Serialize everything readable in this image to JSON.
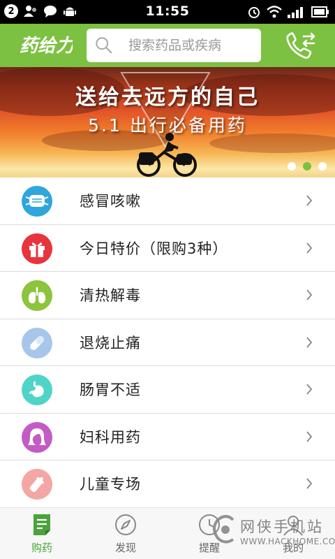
{
  "status_bar": {
    "notification_count": "2",
    "time": "11:55"
  },
  "header": {
    "logo_text": "药给力",
    "search_placeholder": "搜索药品或疾病"
  },
  "banner": {
    "title": "送给去远方的自己",
    "subtitle": "5.1 出行必备用药",
    "dots": 3,
    "active_dot": 1
  },
  "categories": [
    {
      "label": "感冒咳嗽",
      "icon": "mask-icon",
      "color": "#2fa6dd"
    },
    {
      "label": "今日特价（限购3种）",
      "icon": "gift-icon",
      "color": "#e8343c"
    },
    {
      "label": "清热解毒",
      "icon": "lungs-icon",
      "color": "#8cc43c"
    },
    {
      "label": "退烧止痛",
      "icon": "pill-icon",
      "color": "#a8c6ea"
    },
    {
      "label": "肠胃不适",
      "icon": "stomach-icon",
      "color": "#4fd5c8"
    },
    {
      "label": "妇科用药",
      "icon": "woman-icon",
      "color": "#c35bc6"
    },
    {
      "label": "儿童专场",
      "icon": "baby-bottle-icon",
      "color": "#f4a6a4"
    }
  ],
  "tabs": [
    {
      "label": "购药",
      "icon": "shopping-doc-icon",
      "active": true
    },
    {
      "label": "发现",
      "icon": "compass-icon",
      "active": false
    },
    {
      "label": "提醒",
      "icon": "clock-icon",
      "active": false
    },
    {
      "label": "我的",
      "icon": "user-icon",
      "active": false
    }
  ],
  "watermark": {
    "name": "网侠手机站",
    "url": "WWW.HACKHOME.COM"
  },
  "colors": {
    "brand_green": "#7cc142",
    "active_tab": "#4aa33b"
  }
}
